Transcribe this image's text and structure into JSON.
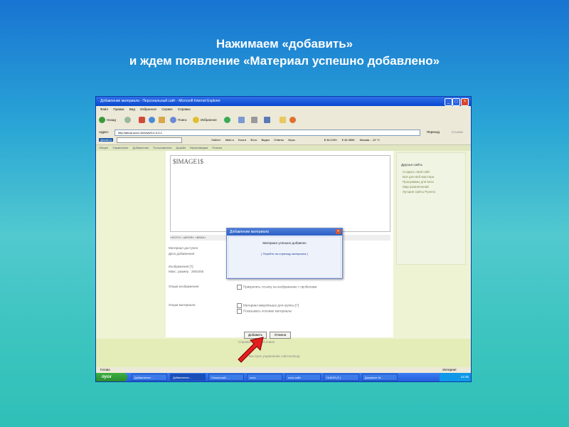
{
  "heading": {
    "line1": "Нажимаем «добавить»",
    "line2": "и ждем появление «Материал успешно добавлено»"
  },
  "browser": {
    "title": "Добавление материала - Персональный сайт - Microsoft Internet Explorer",
    "menu": [
      "Файл",
      "Правка",
      "Вид",
      "Избранное",
      "Сервис",
      "Справка"
    ],
    "toolbar": {
      "back": "Назад",
      "search": "Поиск",
      "favorites": "Избранное"
    },
    "address_label": "Адрес:",
    "address": "http://akuar.ucoz.ru/news/0-0-0-0-1",
    "go": "Переход",
    "links": "Ссылки",
    "links_bar": {
      "brand": "@mail.ru",
      "find": "Найти!",
      "items": [
        "Mail.ru",
        "Блоги",
        "Фото",
        "Видео",
        "Ответы",
        "Игры"
      ],
      "usd": "$ 36.1290",
      "eur": "€ 46.3896",
      "weather": "Москва : -13 °C"
    },
    "status": "Готово",
    "zone": "Интернет"
  },
  "site": {
    "nav": [
      "Общее",
      "Управление",
      "Добавление",
      "Пользователи",
      "Дизайн",
      "Мультимедиа",
      "Поиски"
    ],
    "editor_text": "$IMAGE1$",
    "format_bar": "<ФОТО> <ШРИФ> <ВЕКИ>",
    "fields": [
      {
        "label": "Материал доступен",
        "control": ""
      },
      {
        "label": "Дата добавления",
        "control": ""
      },
      {
        "label": "Изображения [?]",
        "control": "Автоматически создавать эскизы"
      },
      {
        "label": "Макс. размер : 250x250",
        "control": ""
      },
      {
        "label": "Опции изображения",
        "control": "Прикрепить ссылку на изображение с пробелами"
      },
      {
        "label": "Опции материала",
        "control": "Материал вверх/выше для группы [?]"
      },
      {
        "label": "",
        "control": "Показывать похожие материалы"
      }
    ],
    "add_button": "Добавить",
    "cancel_button": "Отмена",
    "footer1": "Справка  Форум  Условия",
    "footer2": "Быстрое управление сайтом  Вход",
    "sidebar": {
      "header": "Друзья сайта",
      "items": [
        "Создать свой сайт",
        "Всё для веб-мастера",
        "Программы для всех",
        "Мир развлечений",
        "Лучшие сайты Рунета"
      ]
    }
  },
  "dialog": {
    "title": "Добавление материала",
    "message": "Материал успешно добавлен",
    "link": "[ Перейти на страницу материала ]"
  },
  "taskbar": {
    "start": "пуск",
    "tasks": [
      "Добавление...",
      "Добавление...",
      "Локальный ...",
      "ucoz",
      "ucoz-сайт",
      "ГАЛИЯ (F:)",
      "Документ М..."
    ],
    "clock": "12:35"
  }
}
